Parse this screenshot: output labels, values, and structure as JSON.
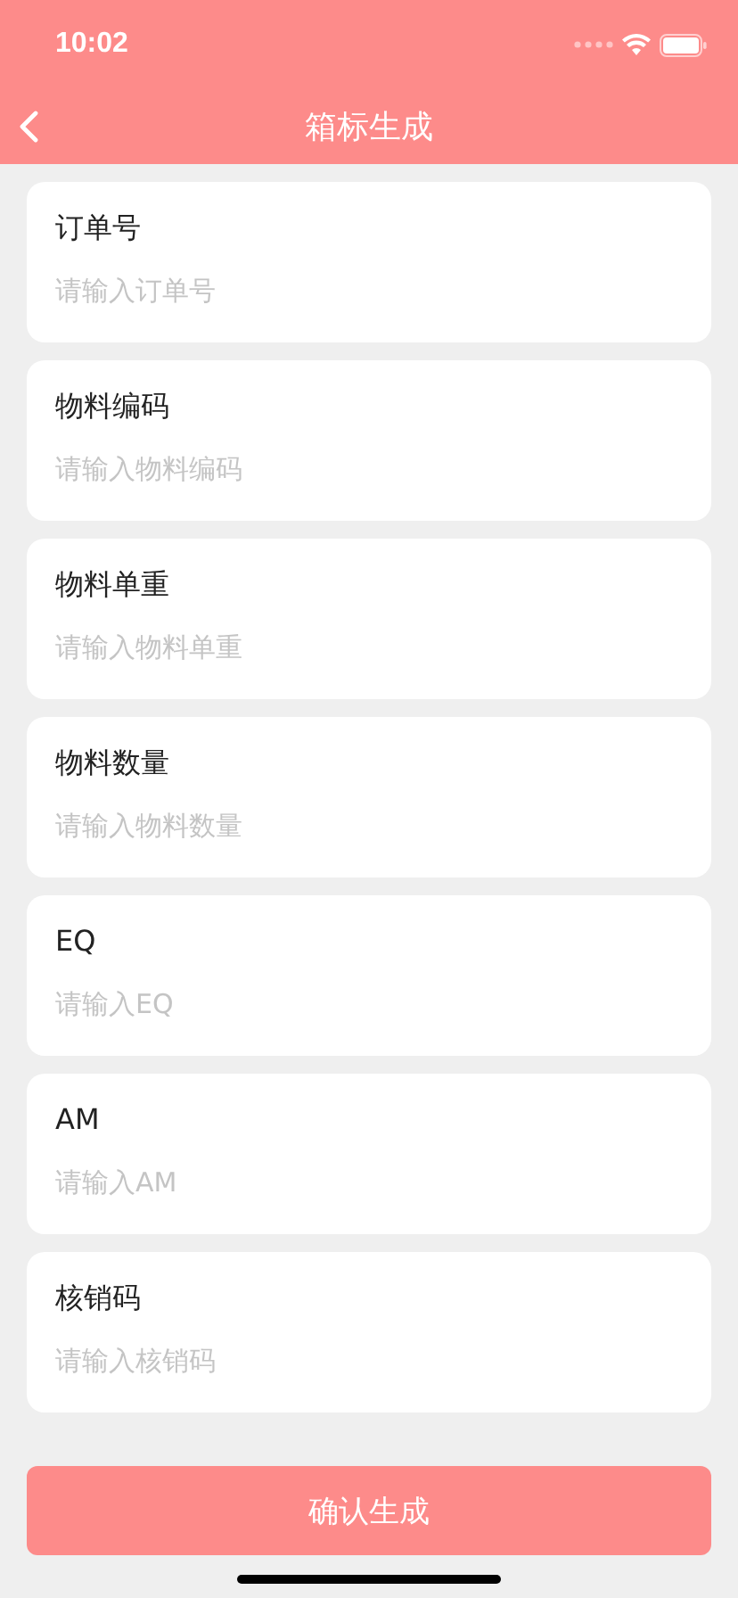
{
  "status_bar": {
    "time": "10:02"
  },
  "nav": {
    "title": "箱标生成"
  },
  "fields": [
    {
      "label": "订单号",
      "placeholder": "请输入订单号"
    },
    {
      "label": "物料编码",
      "placeholder": "请输入物料编码"
    },
    {
      "label": "物料单重",
      "placeholder": "请输入物料单重"
    },
    {
      "label": "物料数量",
      "placeholder": "请输入物料数量"
    },
    {
      "label": "EQ",
      "placeholder": "请输入EQ"
    },
    {
      "label": "AM",
      "placeholder": "请输入AM"
    },
    {
      "label": "核销码",
      "placeholder": "请输入核销码"
    }
  ],
  "submit_button": "确认生成"
}
